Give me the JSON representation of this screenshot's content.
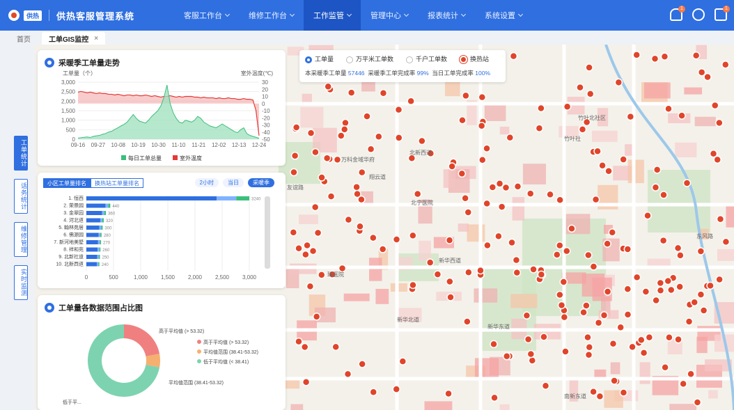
{
  "app": {
    "logo_text": "供热",
    "title": "供热客服管理系统"
  },
  "nav": [
    {
      "label": "客服工作台",
      "active": false
    },
    {
      "label": "维修工作台",
      "active": false
    },
    {
      "label": "工作监管",
      "active": true
    },
    {
      "label": "管理中心",
      "active": false
    },
    {
      "label": "报表统计",
      "active": false
    },
    {
      "label": "系统设置",
      "active": false
    }
  ],
  "header_icons": [
    {
      "name": "bell-icon",
      "badge": "1"
    },
    {
      "name": "chat-icon",
      "badge": ""
    },
    {
      "name": "mail-icon",
      "badge": "1"
    }
  ],
  "tabs": {
    "home": "首页",
    "current": "工单GIS监控",
    "close": "×"
  },
  "left_rail": [
    {
      "label": "工单统计",
      "active": true
    },
    {
      "label": "话务统计",
      "active": false
    },
    {
      "label": "维修管理",
      "active": false
    },
    {
      "label": "实时监测",
      "active": false
    }
  ],
  "trend_panel": {
    "title": "采暖季工单量走势",
    "left_axis_label": "工单量（个）",
    "right_axis_label": "室外温度(℃)",
    "legend": [
      "每日工单总量",
      "室外温度"
    ]
  },
  "rank_panel": {
    "tabs": [
      "小区工单量排名",
      "换热站工单量排名"
    ],
    "ranges": [
      "2小时",
      "当日",
      "采暖季"
    ],
    "active_range": "采暖季"
  },
  "pie_panel": {
    "title": "工单量各数据范围占比图"
  },
  "map_legend": {
    "options": [
      {
        "label": "工单量",
        "checked": true
      },
      {
        "label": "万平米工单数",
        "checked": false
      },
      {
        "label": "千户工单数",
        "checked": false
      }
    ],
    "station_label": "换热站",
    "stats": [
      {
        "label": "本采暖季工单量",
        "value": "57446"
      },
      {
        "label": "采暖季工单完成率",
        "value": "99%"
      },
      {
        "label": "当日工单完成率",
        "value": "100%"
      }
    ]
  },
  "map_labels": [
    "万科金域华府",
    "翔云道",
    "北新西道",
    "珠医院",
    "北宁医院",
    "新华西道",
    "新华东道",
    "新华北道",
    "南新东道",
    "竹叶北社区",
    "竹叶社",
    "友谊路",
    "东风路"
  ],
  "chart_data": [
    {
      "type": "line",
      "title": "采暖季工单量走势",
      "x_ticks": [
        "09-16",
        "09-27",
        "10-08",
        "10-19",
        "10-30",
        "11-10",
        "11-21",
        "12-02",
        "12-13",
        "12-24"
      ],
      "ylabel": "工单量（个）",
      "ylim": [
        0,
        3000
      ],
      "y_ticks": [
        0,
        500,
        1000,
        1500,
        2000,
        2500,
        3000
      ],
      "y2label": "室外温度(℃)",
      "y2lim": [
        -50,
        30
      ],
      "y2_ticks": [
        30,
        20,
        10,
        0,
        -10,
        -20,
        -30,
        -40,
        -50
      ],
      "series": [
        {
          "name": "每日工单总量",
          "color": "#3bbf7a",
          "values": [
            60,
            80,
            100,
            120,
            90,
            150,
            180,
            200,
            260,
            300,
            380,
            420,
            520,
            600,
            700,
            780,
            900,
            1100,
            1300,
            1100,
            950,
            900,
            850,
            1000,
            1200,
            1350,
            1500,
            1750,
            2200,
            2850,
            1900,
            1400,
            1100,
            900,
            850,
            1000,
            950,
            900,
            1000,
            1200,
            1100,
            900,
            800,
            700,
            650,
            600,
            700,
            800,
            700,
            600,
            500,
            400,
            350,
            500,
            600,
            300,
            200,
            150,
            100,
            50
          ]
        },
        {
          "name": "室外温度",
          "color": "#e53935",
          "axis": "right",
          "values": [
            16,
            17,
            16,
            15,
            16,
            15,
            14,
            15,
            14,
            14,
            13,
            13,
            12,
            13,
            12,
            11,
            12,
            12,
            11,
            12,
            11,
            11,
            12,
            11,
            10,
            11,
            10,
            9,
            10,
            10,
            11,
            10,
            9,
            10,
            9,
            10,
            10,
            10,
            9,
            9,
            8,
            9,
            8,
            8,
            8,
            7,
            8,
            7,
            7,
            8,
            7,
            7,
            6,
            6,
            7,
            6,
            6,
            5,
            -10,
            -45
          ]
        }
      ]
    },
    {
      "type": "bar",
      "orientation": "horizontal",
      "categories": [
        "1. 恒西",
        "2. 荣景园",
        "3. 金翠园",
        "4. 河北道",
        "5. 翰林苑居",
        "6. 佛源园",
        "7. 新河地美墅",
        "8. 祥和苑",
        "9. 北新社道",
        "10. 北新西道"
      ],
      "values": [
        3240,
        440,
        360,
        320,
        300,
        280,
        270,
        260,
        250,
        240
      ],
      "xlim": [
        0,
        3000
      ],
      "x_ticks": [
        0,
        500,
        1000,
        1500,
        2000,
        2500,
        3000
      ],
      "colors": [
        "#2f6fe0",
        "#7fb3ff",
        "#3bbf7a"
      ]
    },
    {
      "type": "pie",
      "title": "工单量各数据范围占比图",
      "slices": [
        {
          "label": "高于平均值",
          "range": "(> 53.32)",
          "value": 22,
          "color": "#f08080"
        },
        {
          "label": "平均值范围",
          "range": "(38.41-53.32)",
          "value": 6,
          "color": "#f5b070"
        },
        {
          "label": "低于平均值",
          "range": "(< 38.41)",
          "value": 72,
          "color": "#7dd3b0"
        }
      ]
    }
  ]
}
